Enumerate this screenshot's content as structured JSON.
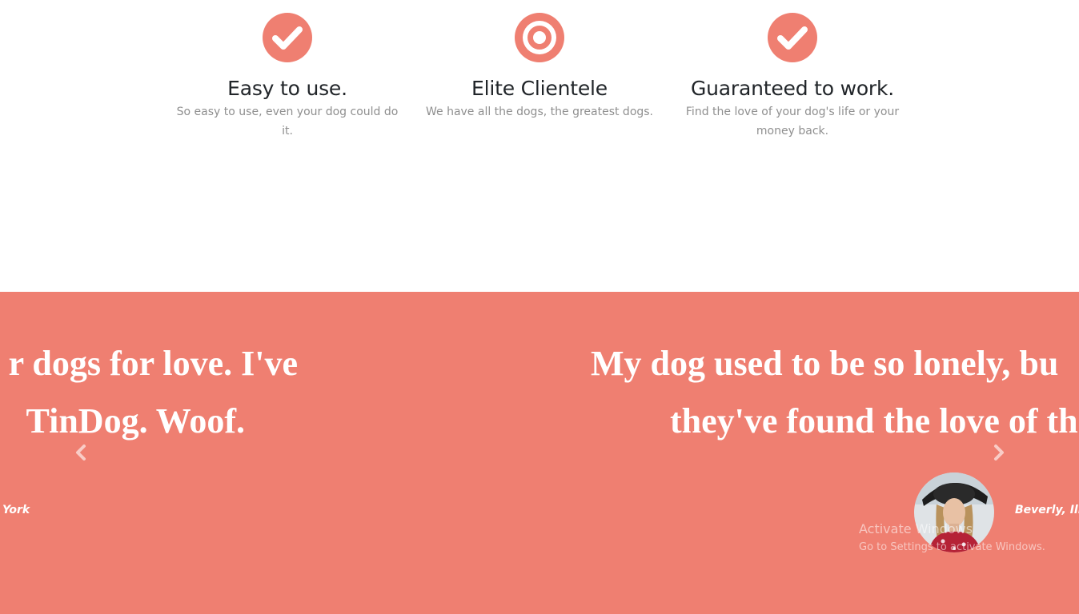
{
  "features": [
    {
      "icon": "check-circle-icon",
      "title": "Easy to use.",
      "description": "So easy to use, even your dog could do it."
    },
    {
      "icon": "bullseye-icon",
      "title": "Elite Clientele",
      "description": "We have all the dogs, the greatest dogs."
    },
    {
      "icon": "check-circle-icon",
      "title": "Guaranteed to work.",
      "description": "Find the love of your dog's life or your money back."
    }
  ],
  "testimonials": {
    "left_quote_line1": "r dogs for love. I've",
    "left_quote_line2": "TinDog. Woof.",
    "left_author": "York",
    "right_quote_line1": "My dog used to be so lonely, bu",
    "right_quote_line2": "they've found the love of th",
    "right_author": "Beverly, Illir",
    "prev_icon": "chevron-left-icon",
    "next_icon": "chevron-right-icon"
  },
  "watermark": {
    "title": "Activate Windows",
    "subtitle": "Go to Settings to activate Windows."
  },
  "colors": {
    "accent": "#ef7f71",
    "heading": "#212529",
    "muted": "#8f8f8f"
  }
}
